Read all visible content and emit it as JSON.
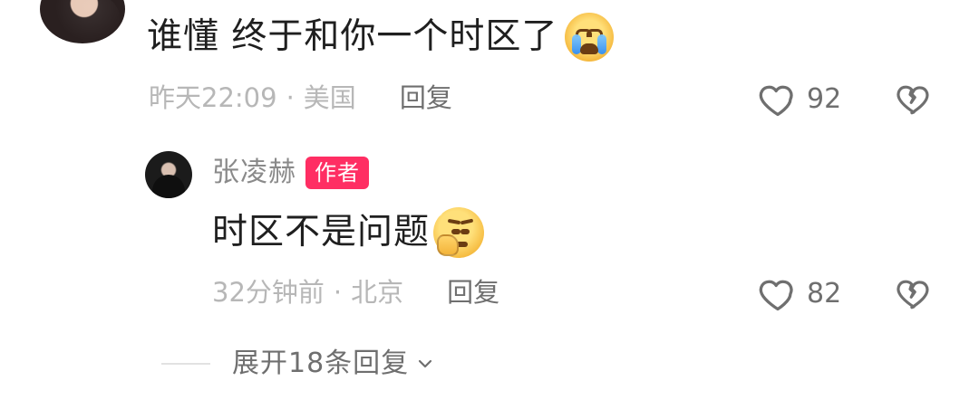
{
  "top_comment": {
    "text": "谁懂 终于和你一个时区了",
    "emoji_name": "crying-emoji",
    "time": "昨天22:09",
    "dot": "·",
    "location": "美国",
    "reply_label": "回复",
    "likes": "92"
  },
  "reply": {
    "username": "张凌赫",
    "badge": "作者",
    "text": "时区不是问题",
    "emoji_name": "thinking-emoji",
    "time": "32分钟前",
    "dot": "·",
    "location": "北京",
    "reply_label": "回复",
    "likes": "82"
  },
  "expand": {
    "label": "展开18条回复"
  },
  "colors": {
    "text_primary": "#1f1f1f",
    "text_meta": "#b7b7b7",
    "text_secondary": "#6f6f6f",
    "badge_bg": "#ff2e63",
    "divider": "#e2e2e2"
  },
  "icons": {
    "heart": "heart-outline-icon",
    "dislike": "broken-heart-outline-icon",
    "chevron": "chevron-down-icon"
  }
}
